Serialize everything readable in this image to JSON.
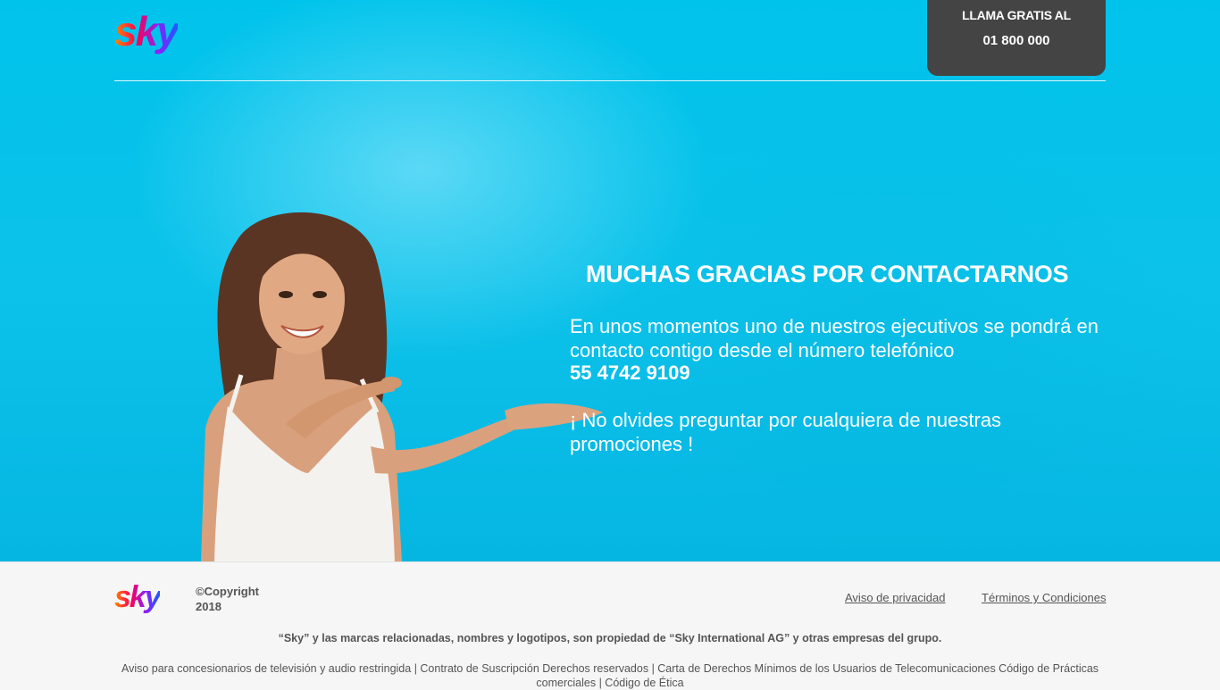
{
  "header": {
    "logo_text": "sky",
    "call_box": {
      "line1": "LLAMA GRATIS AL",
      "line2": "01 800 000"
    }
  },
  "hero": {
    "title": "MUCHAS GRACIAS POR CONTACTARNOS",
    "message": "En unos momentos uno de nuestros ejecutivos se pondrá en contacto contigo desde el número telefónico",
    "phone": "55 4742 9109",
    "reminder": "¡ No olvides preguntar por cualquiera de nuestras promociones !"
  },
  "footer": {
    "logo_text": "sky",
    "copyright": "©Copyright 2018",
    "links": {
      "privacy": "Aviso de privacidad",
      "terms": "Términos y Condiciones"
    },
    "legal_notice": "“Sky” y las marcas relacionadas, nombres y logotipos, son propiedad de “Sky International AG” y otras empresas del grupo.",
    "legal_links": "Aviso para concesionarios de televisión y audio restringida | Contrato de Suscripción Derechos reservados | Carta de Derechos Mínimos de los Usuarios de Telecomunicaciones Código de Prácticas comerciales | Código de Ética"
  },
  "colors": {
    "hero_bg": "#00c3eb",
    "call_box_bg": "#444444",
    "footer_bg": "#f6f6f6"
  }
}
